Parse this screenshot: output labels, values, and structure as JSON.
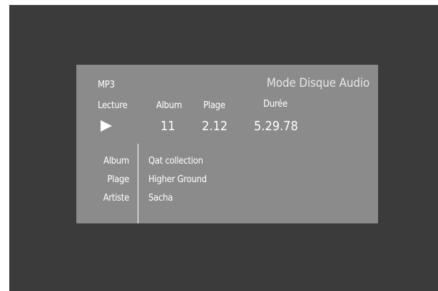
{
  "header": {
    "format": "MP3",
    "mode": "Mode Disque Audio"
  },
  "status": {
    "lecture_label": "Lecture",
    "album_label": "Album",
    "plage_label": "Plage",
    "duree_label": "Durée",
    "album_value": "11",
    "plage_value": "2.12",
    "duree_value": "5.29.78",
    "state_icon": "play-icon"
  },
  "info": {
    "album_label": "Album",
    "plage_label": "Plage",
    "artiste_label": "Artiste",
    "album_value": "Qat collection",
    "plage_value": "Higher Ground",
    "artiste_value": "Sacha"
  },
  "colors": {
    "background": "#3b3b3b",
    "panel": "#8b8b8b",
    "text": "#ffffff"
  }
}
